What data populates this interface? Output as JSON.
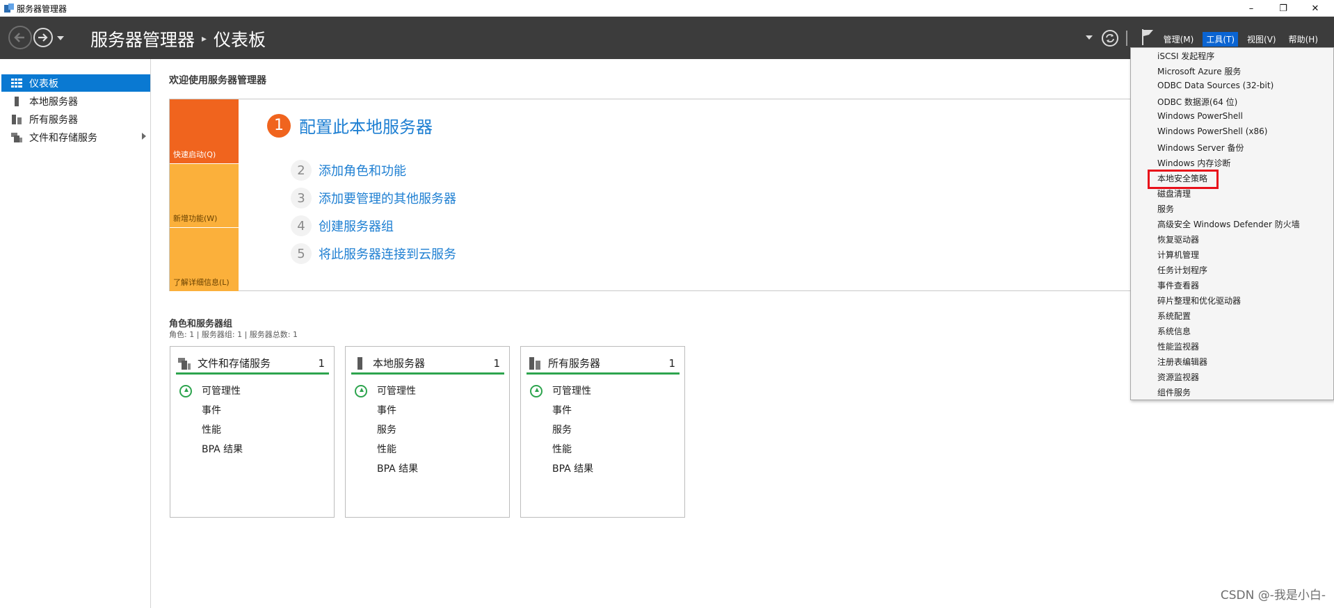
{
  "window": {
    "title": "服务器管理器",
    "controls": {
      "minimize": "–",
      "restore": "❐",
      "close": "✕"
    }
  },
  "header": {
    "breadcrumb_root": "服务器管理器",
    "breadcrumb_sep": "▸",
    "breadcrumb_current": "仪表板",
    "menus": [
      {
        "label": "管理(M)",
        "active": false
      },
      {
        "label": "工具(T)",
        "active": true
      },
      {
        "label": "视图(V)",
        "active": false
      },
      {
        "label": "帮助(H)",
        "active": false
      }
    ]
  },
  "sidebar": {
    "items": [
      {
        "label": "仪表板",
        "icon": "dashboard-icon",
        "active": true
      },
      {
        "label": "本地服务器",
        "icon": "server-icon",
        "active": false
      },
      {
        "label": "所有服务器",
        "icon": "servers-icon",
        "active": false
      },
      {
        "label": "文件和存储服务",
        "icon": "file-storage-icon",
        "active": false,
        "expandable": true
      }
    ]
  },
  "main": {
    "welcome": "欢迎使用服务器管理器",
    "tiles": {
      "quick_start": "快速启动(Q)",
      "whats_new": "新增功能(W)",
      "learn_more": "了解详细信息(L)"
    },
    "configure": {
      "num": "1",
      "label": "配置此本地服务器"
    },
    "steps": [
      {
        "num": "2",
        "label": "添加角色和功能"
      },
      {
        "num": "3",
        "label": "添加要管理的其他服务器"
      },
      {
        "num": "4",
        "label": "创建服务器组"
      },
      {
        "num": "5",
        "label": "将此服务器连接到云服务"
      }
    ],
    "roles_title": "角色和服务器组",
    "roles_sub": "角色: 1 | 服务器组: 1 | 服务器总数: 1",
    "cards": [
      {
        "name": "文件和存储服务",
        "count": "1",
        "rows": [
          "可管理性",
          "事件",
          "性能",
          "BPA 结果"
        ]
      },
      {
        "name": "本地服务器",
        "count": "1",
        "rows": [
          "可管理性",
          "事件",
          "服务",
          "性能",
          "BPA 结果"
        ]
      },
      {
        "name": "所有服务器",
        "count": "1",
        "rows": [
          "可管理性",
          "事件",
          "服务",
          "性能",
          "BPA 结果"
        ]
      }
    ]
  },
  "tools_menu": {
    "items": [
      "iSCSI 发起程序",
      "Microsoft Azure 服务",
      "ODBC Data Sources (32-bit)",
      "ODBC 数据源(64 位)",
      "Windows PowerShell",
      "Windows PowerShell (x86)",
      "Windows Server 备份",
      "Windows 内存诊断",
      "本地安全策略",
      "磁盘清理",
      "服务",
      "高级安全 Windows Defender 防火墙",
      "恢复驱动器",
      "计算机管理",
      "任务计划程序",
      "事件查看器",
      "碎片整理和优化驱动器",
      "系统配置",
      "系统信息",
      "性能监视器",
      "注册表编辑器",
      "资源监视器",
      "组件服务"
    ],
    "highlighted": "本地安全策略"
  },
  "watermark": "CSDN @-我是小白-",
  "colors": {
    "header_bg": "#3c3c3c",
    "accent_blue": "#0a79d2",
    "link_blue": "#1e7fd2",
    "orange": "#f0641e",
    "amber": "#fbb03b",
    "status_green": "#2da44e",
    "highlight_red": "#e8101a"
  }
}
